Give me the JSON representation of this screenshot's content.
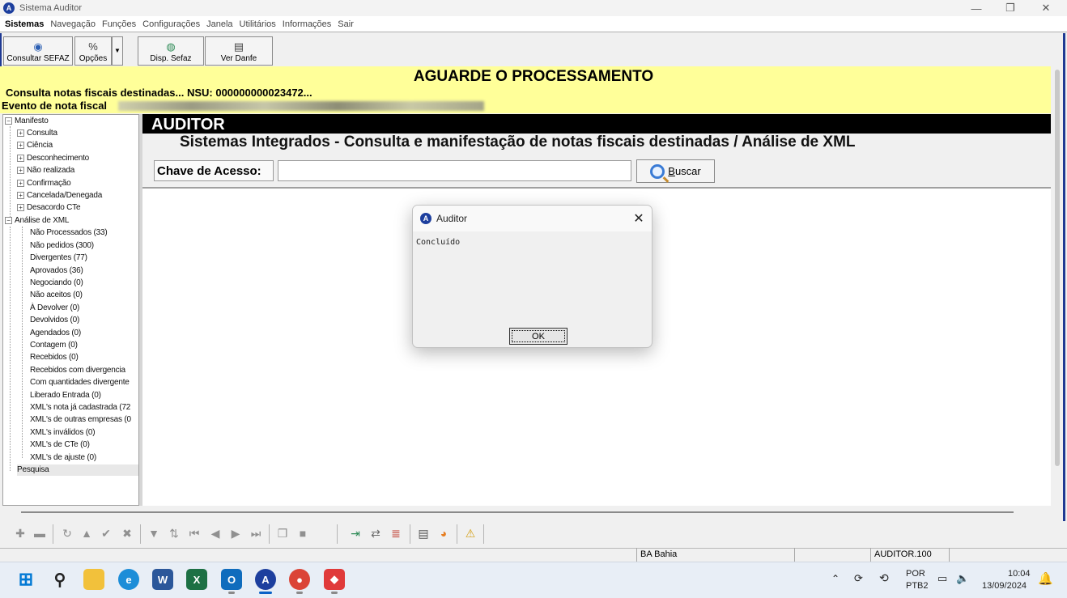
{
  "window": {
    "title": "Sistema Auditor",
    "minimize": "—",
    "maximize": "❐",
    "close": "✕"
  },
  "menu": [
    "Sistemas",
    "Navegação",
    "Funções",
    "Configurações",
    "Janela",
    "Utilitários",
    "Informações",
    "Sair"
  ],
  "toolbar": {
    "consultar_sefaz": "Consultar SEFAZ",
    "opcoes": "Opções",
    "disp_sefaz": "Disp. Sefaz",
    "ver_danfe": "Ver Danfe"
  },
  "banner": {
    "heading": "AGUARDE O PROCESSAMENTO",
    "line1": "Consulta notas fiscais destinadas... NSU: 000000000023472...",
    "line2": "Evento de nota fiscal"
  },
  "tree": {
    "manifesto": "Manifesto",
    "manifesto_children": [
      "Consulta",
      "Ciência",
      "Desconhecimento",
      "Não realizada",
      "Confirmação",
      "Cancelada/Denegada",
      "Desacordo CTe"
    ],
    "analise": "Análise de XML",
    "analise_children": [
      "Não Processados (33)",
      "Não pedidos (300)",
      "Divergentes (77)",
      "Aprovados (36)",
      "Negociando (0)",
      "Não aceitos (0)",
      "À Devolver (0)",
      "Devolvidos (0)",
      "Agendados (0)",
      "Contagem (0)",
      "Recebidos (0)",
      "Recebidos com divergencia",
      "Com quantidades divergente",
      "Liberado Entrada (0)",
      "XML's nota já cadastrada (72",
      "XML's de outras empresas (0",
      "XML's inválidos (0)",
      "XML's de CTe (0)",
      "XML's de ajuste (0)"
    ],
    "pesquisa": "Pesquisa"
  },
  "main": {
    "header": "AUDITOR",
    "subtitle": "Sistemas Integrados - Consulta e manifestação de notas fiscais destinadas / Análise de XML",
    "chave_label": "Chave de Acesso:",
    "chave_value": "",
    "buscar_prefix": "",
    "buscar_underline": "B",
    "buscar_rest": "uscar"
  },
  "dialog": {
    "title": "Auditor",
    "message": "Concluído",
    "ok": "OK"
  },
  "status": {
    "state": "BA Bahia",
    "db": "AUDITOR.100"
  },
  "taskbar": {
    "lang": "POR",
    "layout": "PTB2",
    "time": "10:04",
    "date": "13/09/2024"
  },
  "icons": {
    "app": "A"
  }
}
